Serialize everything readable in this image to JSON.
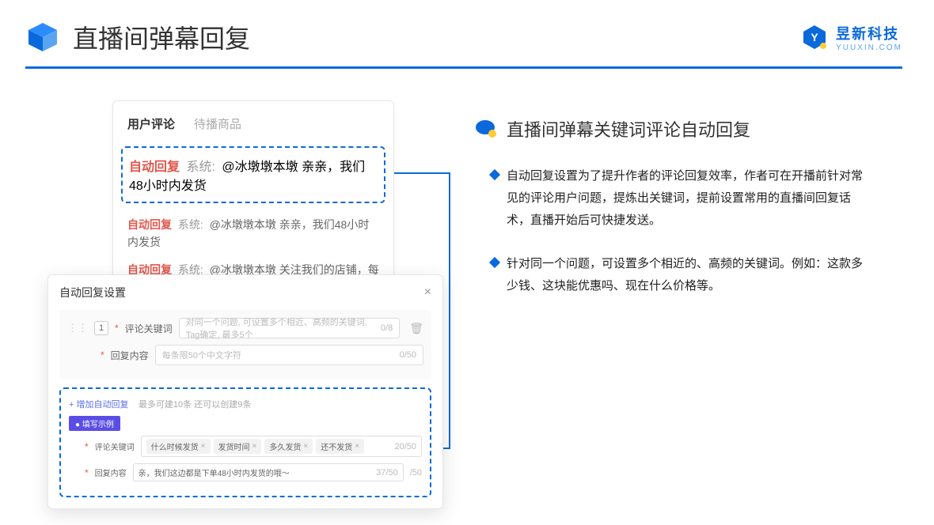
{
  "header": {
    "title": "直播间弹幕回复",
    "brand_cn": "昱新科技",
    "brand_en": "YUUXIN.COM"
  },
  "comments": {
    "tab_active": "用户评论",
    "tab_inactive": "待播商品",
    "highlighted": {
      "tag": "自动回复",
      "sys": "系统:",
      "text": "@冰墩墩本墩 亲亲，我们48小时内发货"
    },
    "lines": [
      {
        "tag": "自动回复",
        "sys": "系统:",
        "text": "@冰墩墩本墩 亲亲，我们48小时内发货"
      },
      {
        "tag": "自动回复",
        "sys": "系统:",
        "text": "@冰墩墩本墩 关注我们的店铺，每日都有热门推荐呦～"
      }
    ]
  },
  "panel": {
    "title": "自动回复设置",
    "row_num": "1",
    "keyword_label": "评论关键词",
    "keyword_placeholder": "对同一个问题, 可设置多个相近、高频的关键词, Tag确定, 最多5个",
    "keyword_count": "0/8",
    "content_label": "回复内容",
    "content_placeholder": "每条限50个中文字符",
    "content_count": "0/50",
    "add_link": "+ 增加自动回复",
    "add_note": "最多可建10条 还可以创建9条",
    "badge": "● 填写示例",
    "ex_keyword_label": "评论关键词",
    "ex_tags": [
      "什么时候发货",
      "发货时间",
      "多久发货",
      "还不发货"
    ],
    "ex_kw_count": "20/50",
    "ex_content_label": "回复内容",
    "ex_content_text": "亲，我们这边都是下单48小时内发货的哦～",
    "ex_content_count": "37/50",
    "outer_count": "/50"
  },
  "right": {
    "section_title": "直播间弹幕关键词评论自动回复",
    "bullets": [
      "自动回复设置为了提升作者的评论回复效率，作者可在开播前针对常见的评论用户问题，提炼出关键词，提前设置常用的直播间回复话术，直播开始后可快捷发送。",
      "针对同一个问题，可设置多个相近的、高频的关键词。例如：这款多少钱、这块能优惠吗、现在什么价格等。"
    ]
  }
}
